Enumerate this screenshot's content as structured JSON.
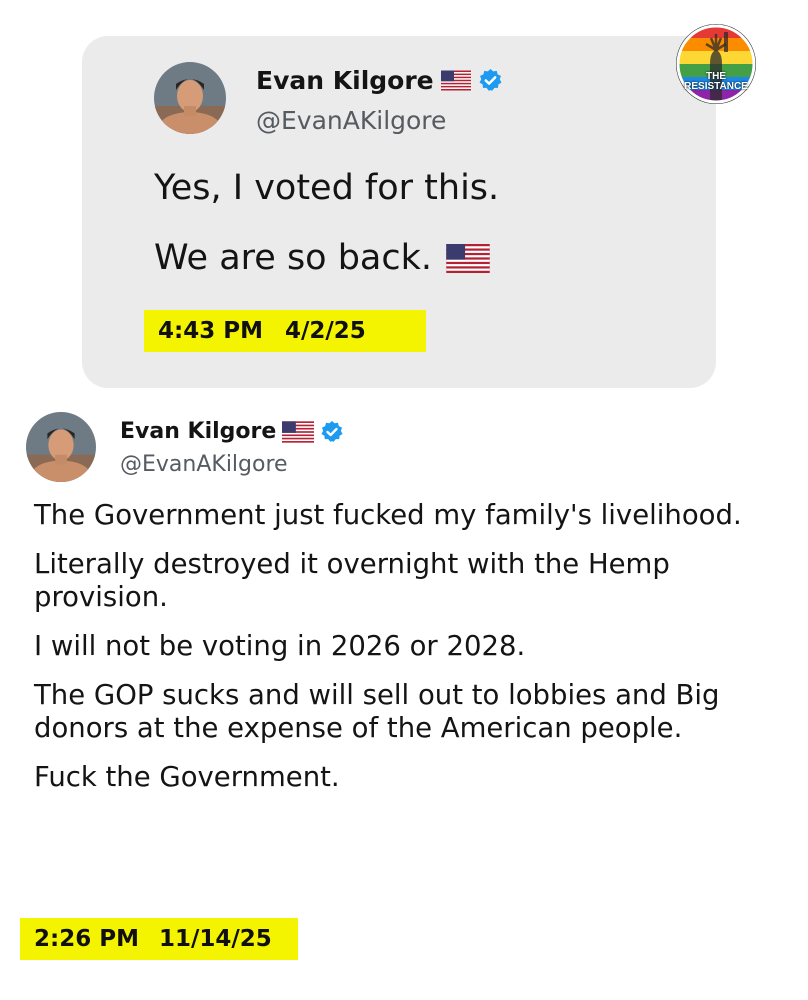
{
  "badge": {
    "line1": "THE",
    "line2": "RESISTANCE"
  },
  "quoted_tweet": {
    "author_name": "Evan Kilgore",
    "handle": "@EvanAKilgore",
    "verified": true,
    "text_lines": [
      "Yes, I voted for this.",
      "We are so back."
    ],
    "time": "4:43 PM",
    "date": "4/2/25",
    "highlight_color": "#f4f400"
  },
  "tweet": {
    "author_name": "Evan Kilgore",
    "handle": "@EvanAKilgore",
    "verified": true,
    "paragraphs": [
      "The Government just fucked my family's livelihood.",
      "Literally destroyed it overnight with the Hemp provision.",
      "I will not be voting in 2026 or 2028.",
      "The GOP sucks and will sell out to lobbies and Big donors at the expense of the American people.",
      "Fuck the Government."
    ],
    "time": "2:26 PM",
    "date": "11/14/25",
    "highlight_color": "#f4f400"
  },
  "colors": {
    "card_background": "#ebebeb",
    "verified_blue": "#1d9bf0",
    "handle_gray": "#555b61"
  },
  "icons": {
    "flag": "us-flag-icon",
    "verified": "verified-badge-icon",
    "badge": "statue-of-liberty-icon"
  }
}
